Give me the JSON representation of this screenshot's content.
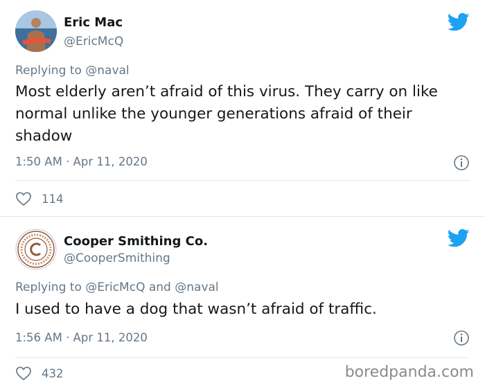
{
  "tweets": [
    {
      "name": "Eric Mac",
      "handle": "@EricMcQ",
      "replying_prefix": "Replying to",
      "replying_to_1": "@naval",
      "replying_joiner": "",
      "replying_to_2": "",
      "text": "Most elderly aren’t afraid of this virus.  They carry on like normal unlike the younger generations afraid of their shadow",
      "timestamp": "1:50 AM · Apr 11, 2020",
      "likes": "114"
    },
    {
      "name": "Cooper Smithing Co.",
      "handle": "@CooperSmithing",
      "replying_prefix": "Replying to",
      "replying_to_1": "@EricMcQ",
      "replying_joiner": "and",
      "replying_to_2": "@naval",
      "text": "I used to have a dog that wasn’t afraid of traffic.",
      "timestamp": "1:56 AM · Apr 11, 2020",
      "likes": "432"
    }
  ],
  "watermark": "boredpanda.com",
  "colors": {
    "brand_blue": "#1da1f2",
    "secondary_text": "#657786",
    "primary_text": "#14171a",
    "divider": "#e1e8ed"
  }
}
